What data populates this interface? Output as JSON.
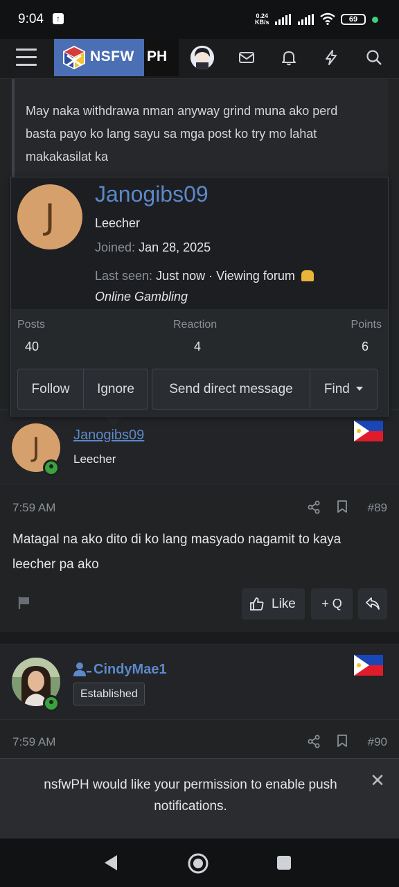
{
  "status": {
    "time": "9:04",
    "net_speed_value": "0.24",
    "net_speed_unit": "KB/s",
    "battery": "69"
  },
  "header": {
    "logo_text": "NSFW",
    "logo_suffix": "PH"
  },
  "quote": {
    "text": "May naka withdrawa nman anyway grind muna ako perd basta payo ko lang sayu sa mga post ko try mo lahat makakasilat ka"
  },
  "member_card": {
    "avatar_letter": "J",
    "username": "Janogibs09",
    "user_title": "Leecher",
    "joined_label": "Joined:",
    "joined_value": "Jan 28, 2025",
    "last_seen_label": "Last seen:",
    "last_seen_value": "Just now · Viewing forum",
    "last_seen_forum": "Online Gambling",
    "stats": [
      {
        "label": "Posts",
        "value": "40"
      },
      {
        "label": "Reaction",
        "value": "4"
      },
      {
        "label": "Points",
        "value": "6"
      }
    ],
    "actions": {
      "follow": "Follow",
      "ignore": "Ignore",
      "message": "Send direct message",
      "find": "Find"
    }
  },
  "posts": [
    {
      "avatar_letter": "J",
      "username": "Janogibs09",
      "user_title": "Leecher",
      "time": "7:59 AM",
      "number": "#89",
      "text": "Matagal na ako dito di ko lang masyado nagamit to kaya leecher pa ako",
      "like_label": "Like",
      "quote_label": "+ Q"
    },
    {
      "username": "CindyMae1",
      "user_title": "Established",
      "time": "7:59 AM",
      "number": "#90"
    }
  ],
  "push_banner": {
    "text": "nsfwPH would like your permission to enable push notifications."
  },
  "colors": {
    "accent": "#5d88c9",
    "background": "#212325",
    "online": "#3aa33d",
    "avatar_bg": "#d6a06c"
  }
}
